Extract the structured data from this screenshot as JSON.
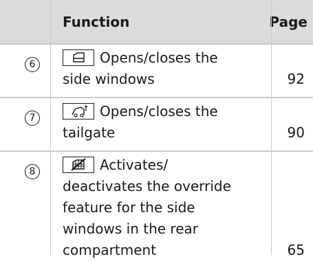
{
  "table": {
    "headers": {
      "function": "Function",
      "page": "Page"
    },
    "rows": [
      {
        "number": "6",
        "icon": "side-window-icon",
        "text_line1": "Opens/closes the",
        "text_lines_rest": [
          "side windows"
        ],
        "page": "92"
      },
      {
        "number": "7",
        "icon": "tailgate-icon",
        "text_line1": "Opens/closes the",
        "text_lines_rest": [
          "tailgate"
        ],
        "page": "90"
      },
      {
        "number": "8",
        "icon": "window-override-icon",
        "text_line1": "Activates/",
        "text_lines_rest": [
          "deactivates the override",
          "feature for the side",
          "windows in the rear",
          "compartment"
        ],
        "page": "65"
      }
    ]
  }
}
